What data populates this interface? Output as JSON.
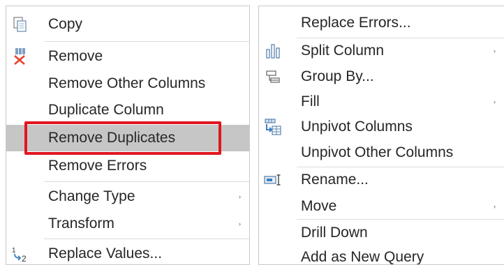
{
  "left_menu": {
    "items": [
      {
        "label": "Copy",
        "icon": "copy-icon",
        "submenu": false
      },
      {
        "label": "Remove",
        "icon": "remove-icon",
        "submenu": false
      },
      {
        "label": "Remove Other Columns",
        "submenu": false
      },
      {
        "label": "Duplicate Column",
        "submenu": false
      },
      {
        "label": "Remove Duplicates",
        "submenu": false,
        "highlighted": true
      },
      {
        "label": "Remove Errors",
        "submenu": false
      },
      {
        "label": "Change Type",
        "submenu": true
      },
      {
        "label": "Transform",
        "submenu": true
      },
      {
        "label": "Replace Values...",
        "icon": "replace-values-icon",
        "submenu": false
      }
    ]
  },
  "right_menu": {
    "items": [
      {
        "label": "Replace Errors...",
        "submenu": false
      },
      {
        "label": "Split Column",
        "icon": "split-column-icon",
        "submenu": true
      },
      {
        "label": "Group By...",
        "icon": "group-by-icon",
        "submenu": false
      },
      {
        "label": "Fill",
        "submenu": true
      },
      {
        "label": "Unpivot Columns",
        "icon": "unpivot-icon",
        "submenu": false
      },
      {
        "label": "Unpivot Other Columns",
        "submenu": false
      },
      {
        "label": "Rename...",
        "icon": "rename-icon",
        "submenu": false
      },
      {
        "label": "Move",
        "submenu": true
      },
      {
        "label": "Drill Down",
        "submenu": false
      },
      {
        "label": "Add as New Query",
        "submenu": false
      }
    ]
  },
  "submenu_arrow": "›",
  "colors": {
    "highlight_row": "#c6c6c6",
    "annotation_box": "#e0161f",
    "remove_icon": "#e8412c",
    "icon_blue": "#3b7fc4"
  }
}
